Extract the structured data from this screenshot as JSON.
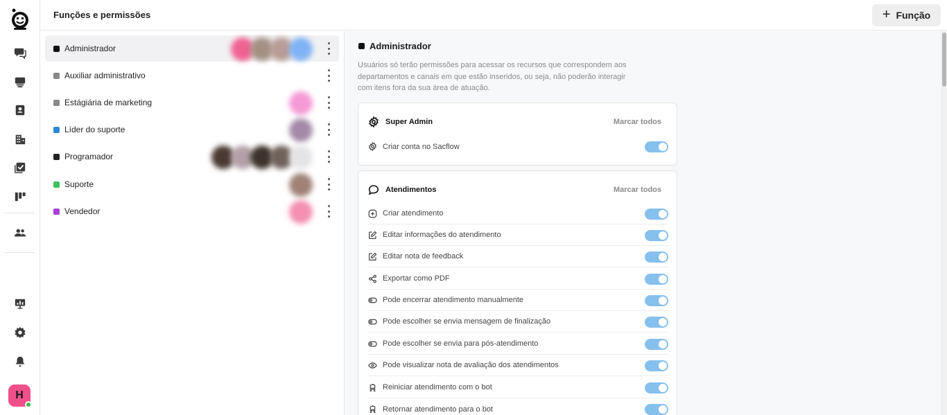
{
  "header": {
    "title": "Funções e permissões",
    "add_button": "Função"
  },
  "nav": {
    "items": [
      {
        "name": "chat-icon"
      },
      {
        "name": "inbox-icon"
      },
      {
        "name": "contacts-icon"
      },
      {
        "name": "building-icon"
      },
      {
        "name": "tasks-icon"
      },
      {
        "name": "kanban-icon"
      },
      {
        "name": "team-icon"
      },
      {
        "name": "monitor-icon"
      },
      {
        "name": "gear-icon"
      },
      {
        "name": "bell-icon"
      }
    ],
    "user_initial": "H"
  },
  "roles": [
    {
      "name": "Administrador",
      "color": "#111111",
      "active": true
    },
    {
      "name": "Auxiliar administrativo",
      "color": "#888888"
    },
    {
      "name": "Estágiária de marketing",
      "color": "#888888"
    },
    {
      "name": "Líder do suporte",
      "color": "#2b88d8"
    },
    {
      "name": "Programador",
      "color": "#222222"
    },
    {
      "name": "Suporte",
      "color": "#3cbf5a"
    },
    {
      "name": "Vendedor",
      "color": "#a640d8"
    }
  ],
  "detail": {
    "title": "Administrador",
    "description": "Usuários só terão permissões para acessar os recursos que correspondem aos departamentos e canais em que estão inseridos, ou seja, não poderão interagir com itens fora da sua área de atuação.",
    "sections": [
      {
        "title": "Super Admin",
        "mark_all": "Marcar todos",
        "icon": "gear-icon",
        "permissions": [
          {
            "label": "Criar conta no Sacflow",
            "icon": "gear-icon",
            "enabled": true
          }
        ]
      },
      {
        "title": "Atendimentos",
        "mark_all": "Marcar todos",
        "icon": "chat-bubble-icon",
        "permissions": [
          {
            "label": "Criar atendimento",
            "icon": "plus-circle-icon",
            "enabled": true
          },
          {
            "label": "Editar informações do atendimento",
            "icon": "edit-icon",
            "enabled": true
          },
          {
            "label": "Editar nota de feedback",
            "icon": "edit-icon",
            "enabled": true
          },
          {
            "label": "Exportar como PDF",
            "icon": "share-icon",
            "enabled": true
          },
          {
            "label": "Pode encerrar atendimento manualmente",
            "icon": "toggle-icon",
            "enabled": true
          },
          {
            "label": "Pode escolher se envia mensagem de finalização",
            "icon": "toggle-icon",
            "enabled": true
          },
          {
            "label": "Pode escolher se envia para pós-atendimento",
            "icon": "toggle-icon",
            "enabled": true
          },
          {
            "label": "Pode visualizar nota de avaliação dos atendimentos",
            "icon": "eye-icon",
            "enabled": true
          },
          {
            "label": "Reiniciar atendimento com o bot",
            "icon": "robot-icon",
            "enabled": true
          },
          {
            "label": "Retornar atendimento para o bot",
            "icon": "robot-icon",
            "enabled": true
          }
        ]
      }
    ]
  }
}
